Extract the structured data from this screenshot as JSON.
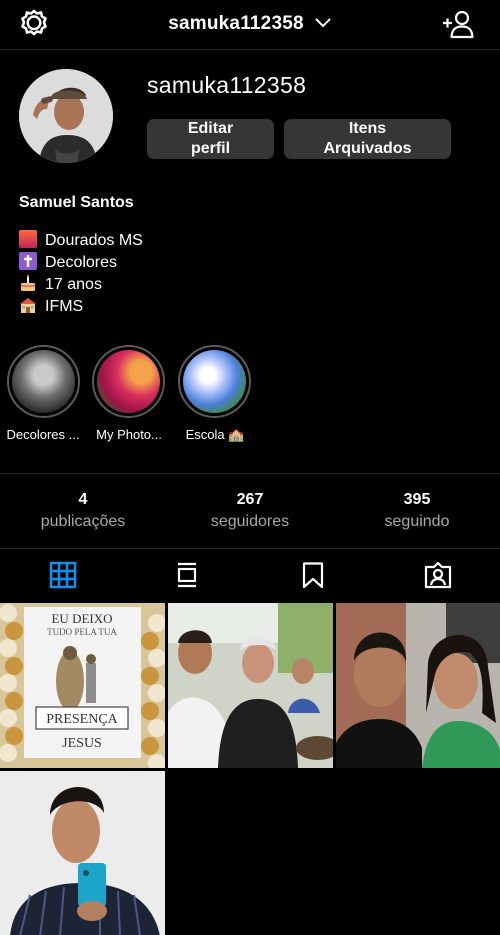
{
  "header": {
    "username": "samuka112358"
  },
  "profile": {
    "username": "samuka112358",
    "full_name": "Samuel Santos",
    "edit_label_1": "Editar",
    "edit_label_2": "perfil",
    "archive_label_1": "Itens",
    "archive_label_2": "Arquivados",
    "bio": [
      {
        "icon": "sunset-city-emoji-icon",
        "text": "Dourados MS"
      },
      {
        "icon": "latin-cross-emoji-icon",
        "text": "Decolores"
      },
      {
        "icon": "birthday-cake-emoji-icon",
        "text": "17 anos"
      },
      {
        "icon": "school-emoji-icon",
        "text": "IFMS"
      }
    ]
  },
  "highlights": [
    {
      "label": "Decolores ..."
    },
    {
      "label": "My Photo..."
    },
    {
      "label": "Escola 🏫"
    }
  ],
  "stats": [
    {
      "value": "4",
      "label": "publicações"
    },
    {
      "value": "267",
      "label": "seguidores"
    },
    {
      "value": "395",
      "label": "seguindo"
    }
  ],
  "tabs": [
    "grid-icon",
    "igtv-icon",
    "saved-icon",
    "tagged-icon"
  ],
  "colors": {
    "active_tab": "#0095f6",
    "button_bg": "#363636",
    "muted_text": "#a8a8a8"
  },
  "posts": [
    {
      "caption": "EU DEIXO TUDO PELA TUA PRESENÇA JESUS"
    },
    {
      "caption": ""
    },
    {
      "caption": ""
    },
    {
      "caption": ""
    }
  ]
}
